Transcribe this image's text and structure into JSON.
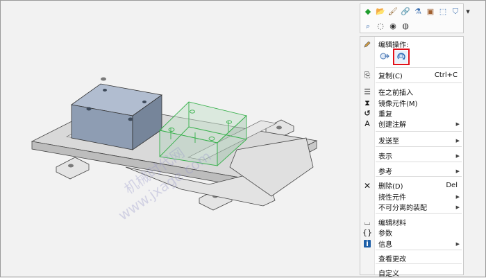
{
  "toolbar": {
    "row1": [
      {
        "icon": "green-diamond-icon",
        "glyph": "◆",
        "color": "#1f9d2e"
      },
      {
        "icon": "open-folder-icon",
        "glyph": "📂",
        "color": "#c08a20"
      },
      {
        "icon": "paintbrush-icon",
        "glyph": "🖌",
        "color": "#8a5a20"
      },
      {
        "icon": "chain-link-icon",
        "glyph": "🔗",
        "color": "#555555"
      },
      {
        "icon": "faucet-icon",
        "glyph": "⚗",
        "color": "#3b6fb0"
      },
      {
        "icon": "appearance-icon",
        "glyph": "▣",
        "color": "#a06030"
      },
      {
        "icon": "select-box-icon",
        "glyph": "⬚",
        "color": "#3b6fb0"
      },
      {
        "icon": "filter-icon",
        "glyph": "⛉",
        "color": "#3b6fb0"
      },
      {
        "icon": "dropdown-arrow-icon",
        "glyph": "▾",
        "color": "#333333"
      }
    ],
    "row2": [
      {
        "icon": "zoom-component-icon",
        "glyph": "⌕",
        "color": "#3b6fb0"
      },
      {
        "icon": "hide-icon",
        "glyph": "◌",
        "color": "#333333"
      },
      {
        "icon": "show-icon",
        "glyph": "◉",
        "color": "#333333"
      },
      {
        "icon": "hide-all-icon",
        "glyph": "◍",
        "color": "#333333"
      }
    ]
  },
  "menu": {
    "edit_section_label": "编辑操作:",
    "items": [
      {
        "name": "copy",
        "label": "复制(C)",
        "shortcut": "Ctrl+C",
        "icon": "copy-icon",
        "glyph": "⎘",
        "submenu": false
      },
      {
        "name": "insert-before",
        "label": "在之前插入",
        "shortcut": "",
        "icon": "insert-before-icon",
        "glyph": "☰",
        "submenu": false
      },
      {
        "name": "mirror-component",
        "label": "镜像元件(M)",
        "shortcut": "",
        "icon": "mirror-icon",
        "glyph": "⧗",
        "submenu": false
      },
      {
        "name": "repeat",
        "label": "重复",
        "shortcut": "",
        "icon": "repeat-icon",
        "glyph": "↺",
        "submenu": false
      },
      {
        "name": "create-annotation",
        "label": "创建注解",
        "shortcut": "",
        "icon": "annotation-icon",
        "glyph": "A",
        "submenu": true
      },
      {
        "name": "send-to",
        "label": "发送至",
        "shortcut": "",
        "icon": "",
        "glyph": "",
        "submenu": true
      },
      {
        "name": "represent",
        "label": "表示",
        "shortcut": "",
        "icon": "",
        "glyph": "",
        "submenu": true
      },
      {
        "name": "reference",
        "label": "参考",
        "shortcut": "",
        "icon": "",
        "glyph": "",
        "submenu": true
      },
      {
        "name": "delete",
        "label": "删除(D)",
        "shortcut": "Del",
        "icon": "delete-icon",
        "glyph": "✕",
        "submenu": false
      },
      {
        "name": "flexible-component",
        "label": "挠性元件",
        "shortcut": "",
        "icon": "",
        "glyph": "",
        "submenu": true
      },
      {
        "name": "inseparable-assembly",
        "label": "不可分离的装配",
        "shortcut": "",
        "icon": "",
        "glyph": "",
        "submenu": true
      },
      {
        "name": "edit-material",
        "label": "编辑材料",
        "shortcut": "",
        "icon": "material-icon",
        "glyph": "⌴",
        "submenu": false
      },
      {
        "name": "parameters",
        "label": "参数",
        "shortcut": "",
        "icon": "parameters-icon",
        "glyph": "{}",
        "submenu": false
      },
      {
        "name": "info",
        "label": "信息",
        "shortcut": "",
        "icon": "info-icon",
        "glyph": "i",
        "submenu": true
      },
      {
        "name": "view-changes",
        "label": "查看更改",
        "shortcut": "",
        "icon": "",
        "glyph": "",
        "submenu": false
      },
      {
        "name": "customize",
        "label": "自定义",
        "shortcut": "",
        "icon": "",
        "glyph": "",
        "submenu": false
      }
    ]
  },
  "watermark": {
    "line1": "机械时代网",
    "line2": "www.jxage.com"
  },
  "colors": {
    "highlight_outline": "#e0101a",
    "selected_part": "#36b04a",
    "block": "#8e9db3",
    "plate": "#d9d9d9"
  }
}
